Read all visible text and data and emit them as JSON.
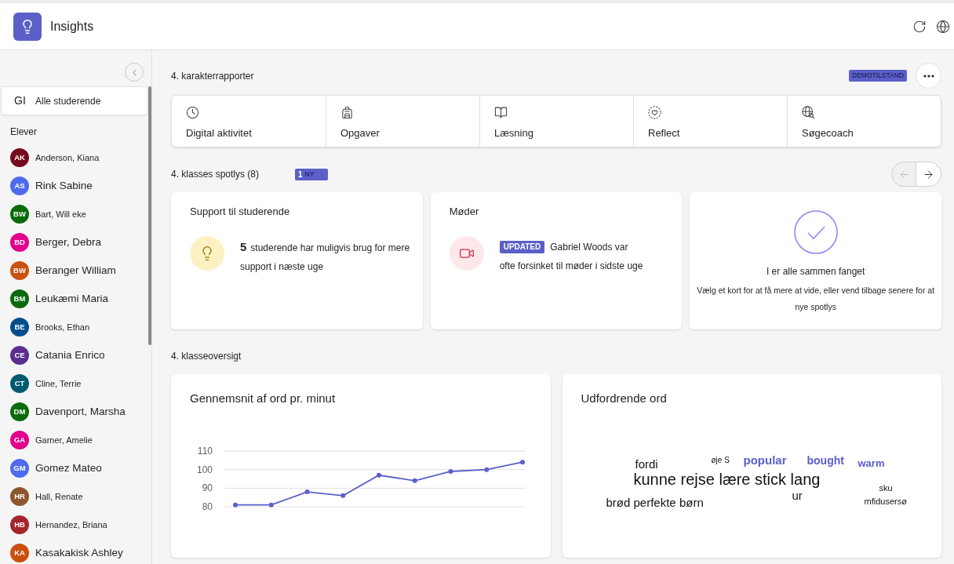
{
  "header": {
    "title": "Insights"
  },
  "sidebar": {
    "all_item": {
      "initials": "GI",
      "label": "Alle studerende",
      "selected": true
    },
    "section_label": "Elever",
    "students": [
      {
        "initials": "AK",
        "name": "Anderson, Kiana",
        "color": "#750b1c",
        "selected": false
      },
      {
        "initials": "AS",
        "name": "Rink Sabine",
        "color": "#4f6bed",
        "selected": false
      },
      {
        "initials": "BW",
        "name": "Bart, Will eke",
        "color": "#0b6a0b",
        "selected": false
      },
      {
        "initials": "BD",
        "name": "Berger, Debra",
        "color": "#e3008c",
        "selected": false
      },
      {
        "initials": "BW",
        "name": "Beranger William",
        "color": "#ca5010",
        "selected": false
      },
      {
        "initials": "BM",
        "name": "Leukæmi Maria",
        "color": "#0b6a0b",
        "selected": false
      },
      {
        "initials": "BE",
        "name": "Brooks, Ethan",
        "color": "#004e8c",
        "selected": false
      },
      {
        "initials": "CE",
        "name": "Catania Enrico",
        "color": "#5c2e91",
        "selected": false
      },
      {
        "initials": "CT",
        "name": "Cline, Terrie",
        "color": "#005b70",
        "selected": false
      },
      {
        "initials": "DM",
        "name": "Davenport, Marsha",
        "color": "#0b6a0b",
        "selected": false
      },
      {
        "initials": "GA",
        "name": "Garner, Amelie",
        "color": "#e3008c",
        "selected": false
      },
      {
        "initials": "GM",
        "name": "Gomez Mateo",
        "color": "#4f6bed",
        "selected": false
      },
      {
        "initials": "HR",
        "name": "Hall, Renate",
        "color": "#8e562e",
        "selected": false
      },
      {
        "initials": "HB",
        "name": "Hernandez, Briana",
        "color": "#a4262c",
        "selected": false
      },
      {
        "initials": "KA",
        "name": "Kasakakisk Ashley",
        "color": "#ca5010",
        "selected": false
      }
    ]
  },
  "reports": {
    "title": "4. karakterrapporter",
    "badge": "DEMOTILSTAND",
    "tiles": [
      {
        "kind": "digital",
        "label": "Digital aktivitet"
      },
      {
        "kind": "assignments",
        "label": "Opgaver"
      },
      {
        "kind": "reading",
        "label": "Læsning"
      },
      {
        "kind": "reflect",
        "label": "Reflect"
      },
      {
        "kind": "search",
        "label": "Søgecoach"
      }
    ]
  },
  "spotlights": {
    "title": "4. klasses spotlys (8)",
    "new_badge": {
      "count": "1",
      "label": "NY"
    },
    "nav": [
      {
        "kind": "previous",
        "disabled": true
      },
      {
        "kind": "next",
        "disabled": false
      }
    ],
    "cards": [
      {
        "kind": "support",
        "title": "Support til studerende",
        "count": "5",
        "text": "studerende har muligvis brug for mere support i næste uge"
      },
      {
        "kind": "meeting",
        "title": "Møder",
        "badge": "UPDATED",
        "text": "Gabriel Woods var ofte forsinket til møder i sidste uge"
      },
      {
        "kind": "done",
        "title": "I er alle sammen fanget",
        "text": "Vælg et kort for at få mere at vide, eller vend tilbage senere for at nye spotlys"
      }
    ]
  },
  "overview": {
    "title": "4. klasseoversigt",
    "wpm_card": {
      "title": "Gennemsnit af ord pr. minut",
      "chart_data": {
        "type": "line",
        "categories": [
          null,
          null,
          null,
          null,
          null,
          null,
          null,
          null,
          null
        ],
        "series": [
          {
            "color": "#5b5fc7",
            "marker": "circle",
            "values": [
              81,
              81,
              88,
              86,
              97,
              94,
              99,
              100,
              104
            ]
          }
        ],
        "ylim": [
          80,
          110
        ],
        "yticks": [
          80,
          90,
          100,
          110
        ]
      }
    },
    "words_card": {
      "title": "Udfordrende ord",
      "words": [
        {
          "text": "fordi",
          "kind": "plain"
        },
        {
          "text": "øje S",
          "kind": "plain"
        },
        {
          "text": "popular",
          "kind": "highlight"
        },
        {
          "text": "bought",
          "kind": "highlight"
        },
        {
          "text": "warm",
          "kind": "highlight"
        },
        {
          "text": "kunne rejse lære stick lang",
          "kind": "plain"
        },
        {
          "text": "sku",
          "kind": "plain"
        },
        {
          "text": "ur",
          "kind": "plain"
        },
        {
          "text": "brød perfekte børn",
          "kind": "plain"
        },
        {
          "text": "mfidusersø",
          "kind": "plain"
        }
      ]
    }
  }
}
